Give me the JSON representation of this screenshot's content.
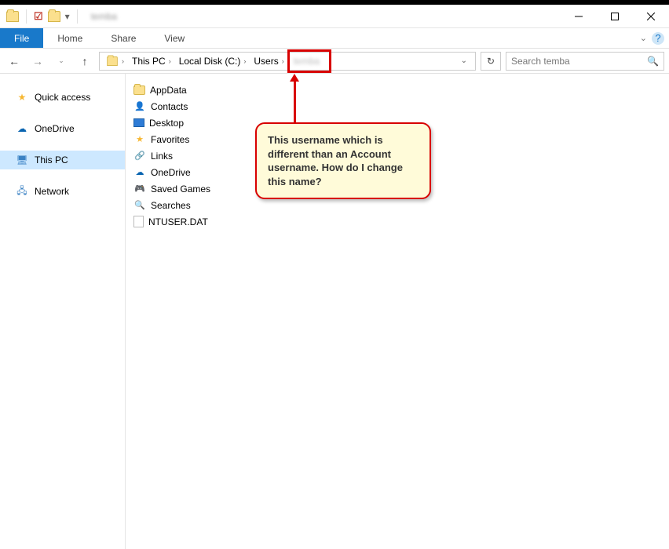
{
  "titlebar": {
    "title": "temba"
  },
  "ribbon": {
    "file": "File",
    "tabs": [
      "Home",
      "Share",
      "View"
    ]
  },
  "address": {
    "segments": [
      "This PC",
      "Local Disk (C:)",
      "Users"
    ],
    "current_blur": "temba"
  },
  "search": {
    "placeholder": "Search temba"
  },
  "sidebar": {
    "quick_access": "Quick access",
    "onedrive": "OneDrive",
    "this_pc": "This PC",
    "network": "Network"
  },
  "files": [
    {
      "name": "AppData",
      "type": "folder"
    },
    {
      "name": "Contacts",
      "type": "contacts"
    },
    {
      "name": "Desktop",
      "type": "desktop"
    },
    {
      "name": "Favorites",
      "type": "star"
    },
    {
      "name": "Links",
      "type": "link"
    },
    {
      "name": "OneDrive",
      "type": "cloud"
    },
    {
      "name": "Saved Games",
      "type": "game"
    },
    {
      "name": "Searches",
      "type": "search"
    },
    {
      "name": "NTUSER.DAT",
      "type": "file"
    }
  ],
  "annotation": {
    "text": "This username which is different than an Account username. How do I change this name?"
  }
}
